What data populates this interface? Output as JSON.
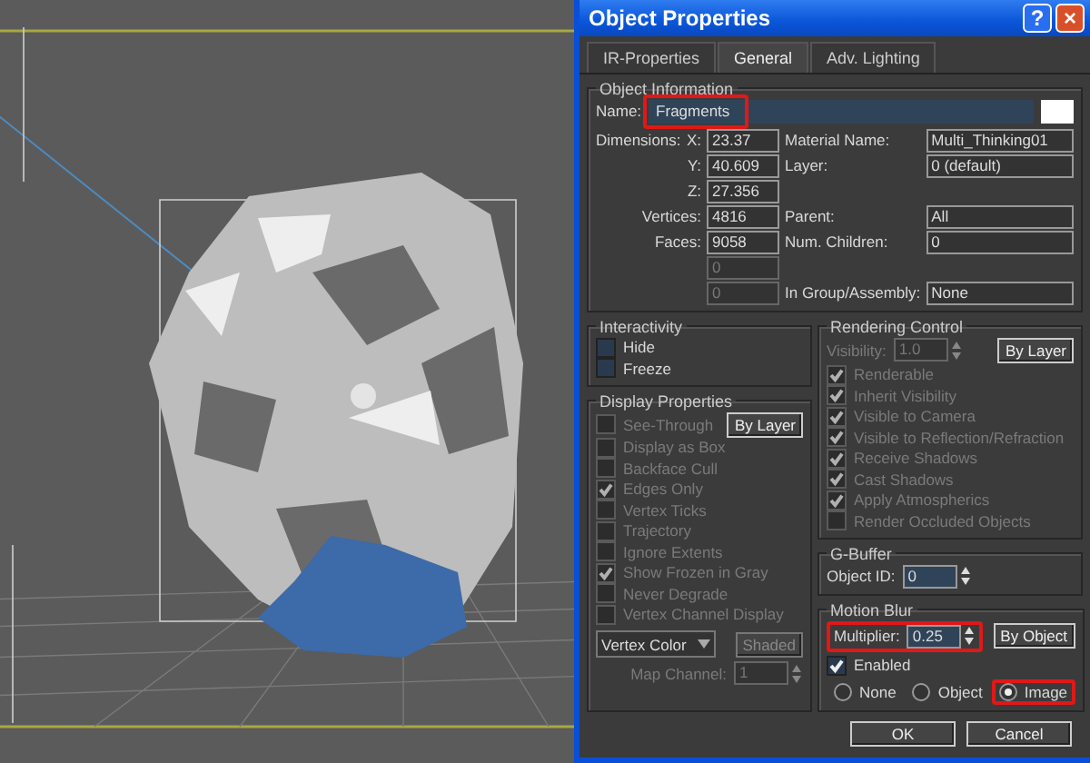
{
  "dialog": {
    "title": "Object Properties",
    "help_button": "?",
    "close_button": "×",
    "tabs": [
      {
        "label": "IR-Properties",
        "selected": false
      },
      {
        "label": "General",
        "selected": true
      },
      {
        "label": "Adv. Lighting",
        "selected": false
      }
    ],
    "object_information": {
      "title": "Object Information",
      "name_label": "Name:",
      "name": "Fragments",
      "name_highlighted": true,
      "rows": [
        {
          "caption": "Dimensions:",
          "label": "X:",
          "value": "23.37",
          "right_label": "Material Name:",
          "right_value": "Multi_Thinking01"
        },
        {
          "label": "Y:",
          "value": "40.609",
          "right_label": "Layer:",
          "right_value": "0 (default)"
        },
        {
          "label": "Z:",
          "value": "27.356"
        },
        {
          "label": "Vertices:",
          "value": "4816",
          "right_label": "Parent:",
          "right_value": "All"
        },
        {
          "label": "Faces:",
          "value": "9058",
          "right_label": "Num. Children:",
          "right_value": "0"
        },
        {
          "value": "0",
          "disabled": true
        },
        {
          "value": "0",
          "disabled": true,
          "right_label": "In Group/Assembly:",
          "right_value": "None"
        }
      ]
    },
    "interactivity": {
      "title": "Interactivity",
      "options": [
        {
          "label": "Hide",
          "checked": false,
          "disabled": false
        },
        {
          "label": "Freeze",
          "checked": false,
          "disabled": false
        }
      ]
    },
    "display_properties": {
      "title": "Display Properties",
      "by_layer_button": "By Layer",
      "options": [
        {
          "label": "See-Through",
          "checked": false,
          "disabled": true
        },
        {
          "label": "Display as Box",
          "checked": false,
          "disabled": true
        },
        {
          "label": "Backface Cull",
          "checked": false,
          "disabled": true
        },
        {
          "label": "Edges Only",
          "checked": true,
          "disabled": true
        },
        {
          "label": "Vertex Ticks",
          "checked": false,
          "disabled": true
        },
        {
          "label": "Trajectory",
          "checked": false,
          "disabled": true
        },
        {
          "label": "Ignore Extents",
          "checked": false,
          "disabled": true
        },
        {
          "label": "Show Frozen in Gray",
          "checked": true,
          "disabled": true
        },
        {
          "label": "Never Degrade",
          "checked": false,
          "disabled": true
        },
        {
          "label": "Vertex Channel Display",
          "checked": false,
          "disabled": true
        }
      ],
      "color_dropdown": "Vertex Color",
      "shaded_button": "Shaded",
      "map_channel_label": "Map Channel:",
      "map_channel": "1"
    },
    "rendering_control": {
      "title": "Rendering Control",
      "visibility_label": "Visibility:",
      "visibility": "1.0",
      "by_layer_button": "By Layer",
      "options": [
        {
          "label": "Renderable",
          "checked": true,
          "disabled": true
        },
        {
          "label": "Inherit Visibility",
          "checked": true,
          "disabled": true
        },
        {
          "label": "Visible to Camera",
          "checked": true,
          "disabled": true
        },
        {
          "label": "Visible to Reflection/Refraction",
          "checked": true,
          "disabled": true
        },
        {
          "label": "Receive Shadows",
          "checked": true,
          "disabled": true
        },
        {
          "label": "Cast Shadows",
          "checked": true,
          "disabled": true
        },
        {
          "label": "Apply Atmospherics",
          "checked": true,
          "disabled": true
        },
        {
          "label": "Render Occluded Objects",
          "checked": false,
          "disabled": true
        }
      ]
    },
    "g_buffer": {
      "title": "G-Buffer",
      "object_id_label": "Object ID:",
      "object_id": "0"
    },
    "motion_blur": {
      "title": "Motion Blur",
      "multiplier_label": "Multiplier:",
      "multiplier": "0.25",
      "multiplier_highlighted": true,
      "by_object_button": "By Object",
      "enabled": {
        "label": "Enabled",
        "checked": true,
        "disabled": false
      },
      "modes": [
        {
          "label": "None",
          "selected": false,
          "highlighted": false
        },
        {
          "label": "Object",
          "selected": false,
          "highlighted": false
        },
        {
          "label": "Image",
          "selected": true,
          "highlighted": true
        }
      ]
    },
    "buttons": [
      "OK",
      "Cancel"
    ]
  }
}
